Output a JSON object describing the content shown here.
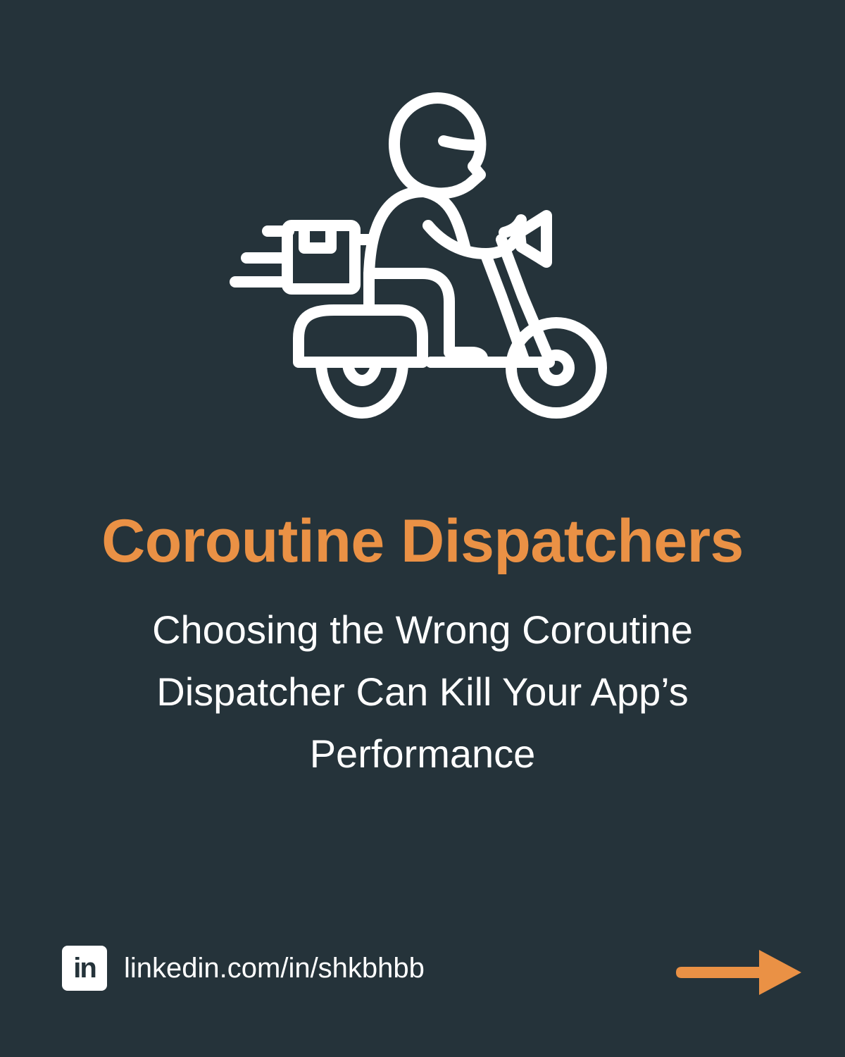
{
  "colors": {
    "background": "#25333a",
    "accent": "#ea9145",
    "text": "#ffffff"
  },
  "hero": {
    "icon": "delivery-scooter-icon"
  },
  "title": "Coroutine Dispatchers",
  "subtitle_lines": [
    "Choosing the Wrong Coroutine",
    "Dispatcher Can Kill Your App’s",
    "Performance"
  ],
  "footer": {
    "logo_text": "in",
    "logo_icon": "linkedin-icon",
    "url": "linkedin.com/in/shkbhbb"
  },
  "next": {
    "icon": "arrow-right-icon"
  }
}
